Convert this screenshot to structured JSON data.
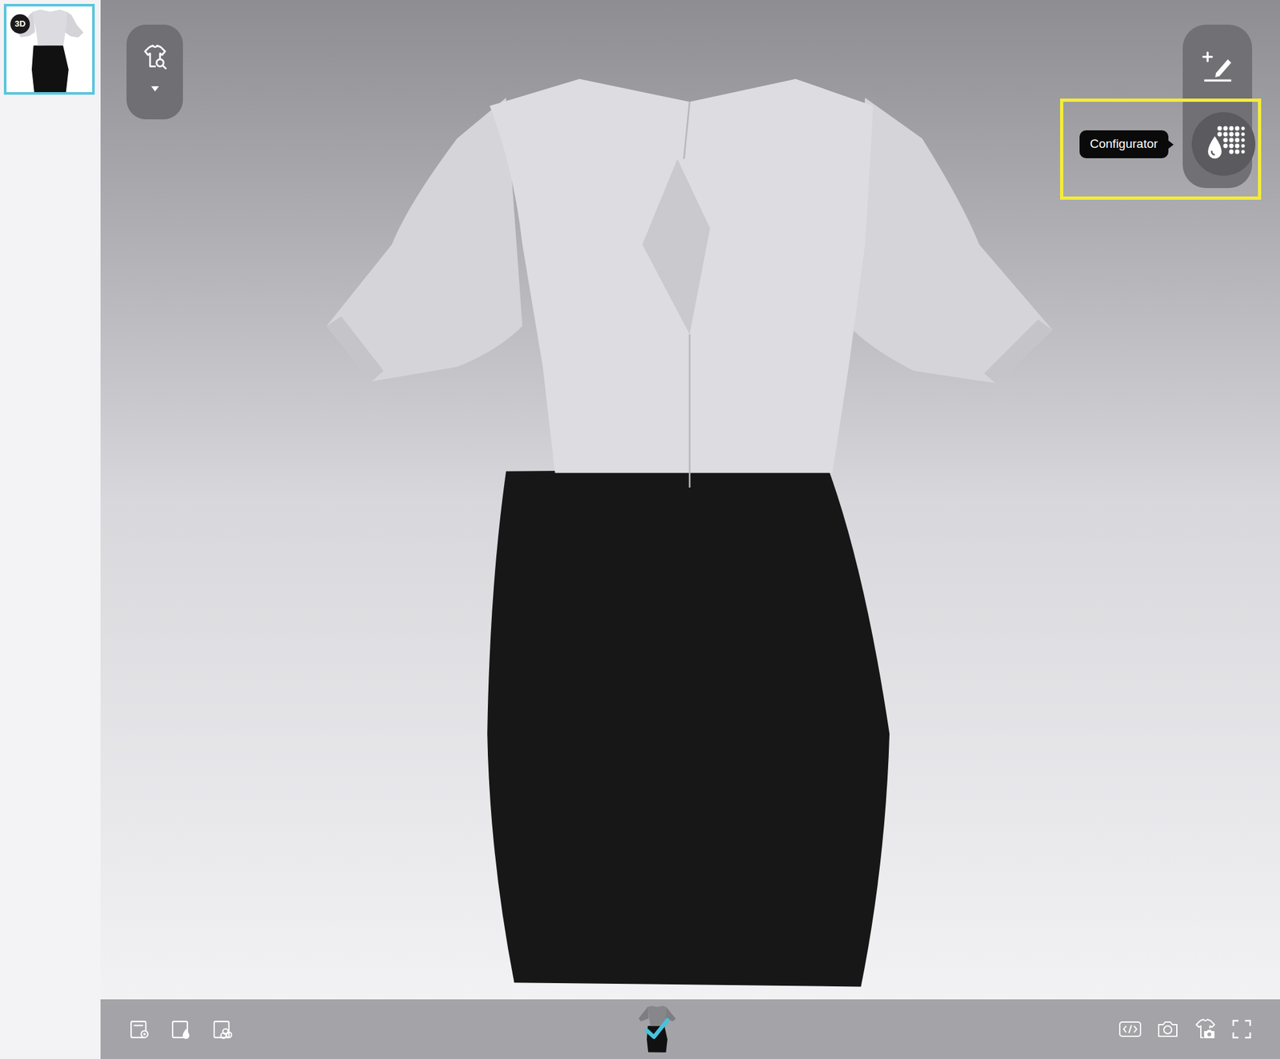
{
  "sidebar": {
    "thumbnails": [
      {
        "badge": "3D",
        "selected": true
      }
    ]
  },
  "configurator": {
    "tooltip": "Configurator",
    "highlighted": true
  },
  "bottom_bar": {
    "colorways": [
      {
        "selected": true
      }
    ]
  }
}
